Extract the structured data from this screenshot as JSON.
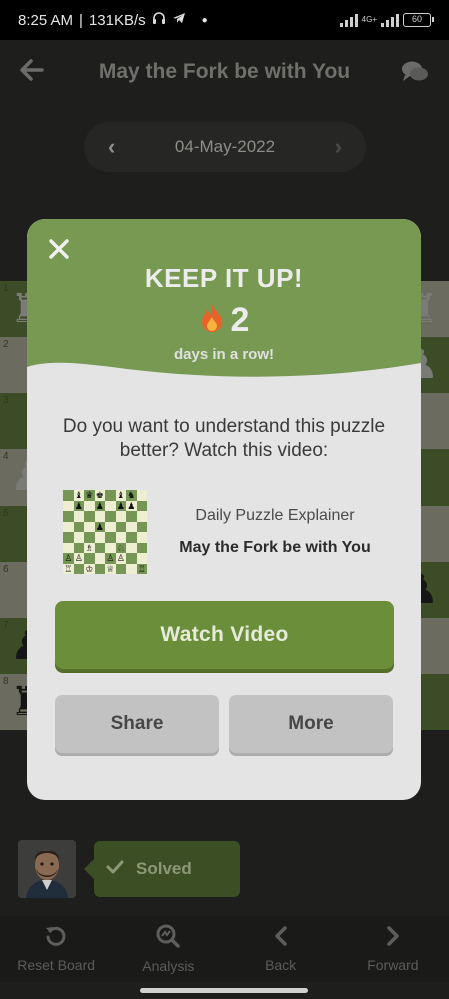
{
  "status_bar": {
    "time": "8:25 AM",
    "speed": "131KB/s",
    "network": "4G+",
    "battery": "60"
  },
  "header": {
    "title": "May the Fork be with You",
    "back_icon": "arrow-left-icon",
    "chat_icon": "chat-bubbles-icon"
  },
  "date_nav": {
    "date": "04-May-2022"
  },
  "board": {
    "ranks": [
      "1",
      "2",
      "3",
      "4",
      "5",
      "6",
      "7",
      "8"
    ]
  },
  "modal": {
    "streak_title": "KEEP IT UP!",
    "streak_count": "2",
    "streak_sub": "days in a row!",
    "question": "Do you want to understand this puzzle better? Watch this video:",
    "video_category": "Daily Puzzle Explainer",
    "video_title": "May the Fork be with You",
    "watch_label": "Watch Video",
    "share_label": "Share",
    "more_label": "More",
    "colors": {
      "header_green": "#779952",
      "button_green": "#6b8e3a"
    }
  },
  "solved": {
    "label": "Solved"
  },
  "bottom_nav": {
    "items": [
      {
        "label": "Reset Board",
        "icon": "reset-icon"
      },
      {
        "label": "Analysis",
        "icon": "analysis-icon"
      },
      {
        "label": "Back",
        "icon": "chevron-left-icon"
      },
      {
        "label": "Forward",
        "icon": "chevron-right-icon"
      }
    ]
  }
}
